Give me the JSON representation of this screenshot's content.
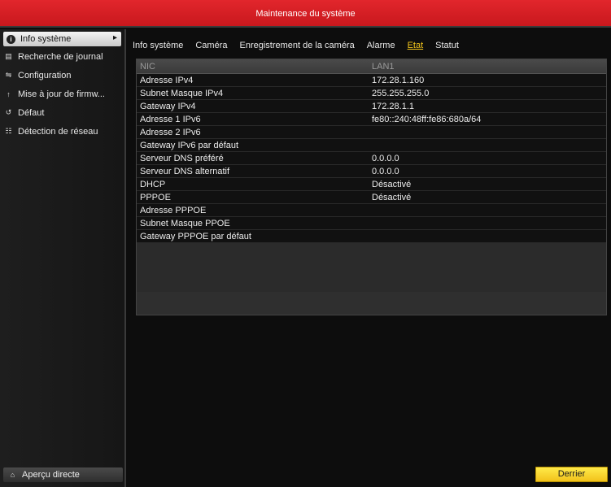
{
  "title": "Maintenance du système",
  "sidebar": {
    "items": [
      {
        "label": "Info système",
        "icon": "info-icon"
      },
      {
        "label": "Recherche de journal",
        "icon": "log-icon"
      },
      {
        "label": "Configuration",
        "icon": "config-icon"
      },
      {
        "label": "Mise à jour de firmw...",
        "icon": "upgrade-icon"
      },
      {
        "label": "Défaut",
        "icon": "default-icon"
      },
      {
        "label": "Détection de réseau",
        "icon": "network-icon"
      }
    ],
    "bottom_label": "Aperçu directe"
  },
  "tabs": [
    "Info système",
    "Caméra",
    "Enregistrement de la caméra",
    "Alarme",
    "Etat",
    "Statut"
  ],
  "active_tab": "Etat",
  "table": {
    "header": [
      "NIC",
      "LAN1"
    ],
    "rows": [
      [
        "Adresse IPv4",
        "172.28.1.160"
      ],
      [
        "Subnet Masque IPv4",
        "255.255.255.0"
      ],
      [
        "Gateway IPv4",
        "172.28.1.1"
      ],
      [
        "Adresse 1 IPv6",
        "fe80::240:48ff:fe86:680a/64"
      ],
      [
        "Adresse 2 IPv6",
        ""
      ],
      [
        "Gateway IPv6 par défaut",
        ""
      ],
      [
        "Serveur DNS préféré",
        "0.0.0.0"
      ],
      [
        "Serveur DNS alternatif",
        "0.0.0.0"
      ],
      [
        "DHCP",
        "Désactivé"
      ],
      [
        "PPPOE",
        "Désactivé"
      ],
      [
        "Adresse PPPOE",
        ""
      ],
      [
        "Subnet Masque PPOE",
        ""
      ],
      [
        "Gateway PPPOE par défaut",
        ""
      ]
    ]
  },
  "last_button": "Derrier",
  "colors": {
    "titlebar": "#d81f25",
    "active_tab": "#f2c51c",
    "button": "#f5d020"
  }
}
